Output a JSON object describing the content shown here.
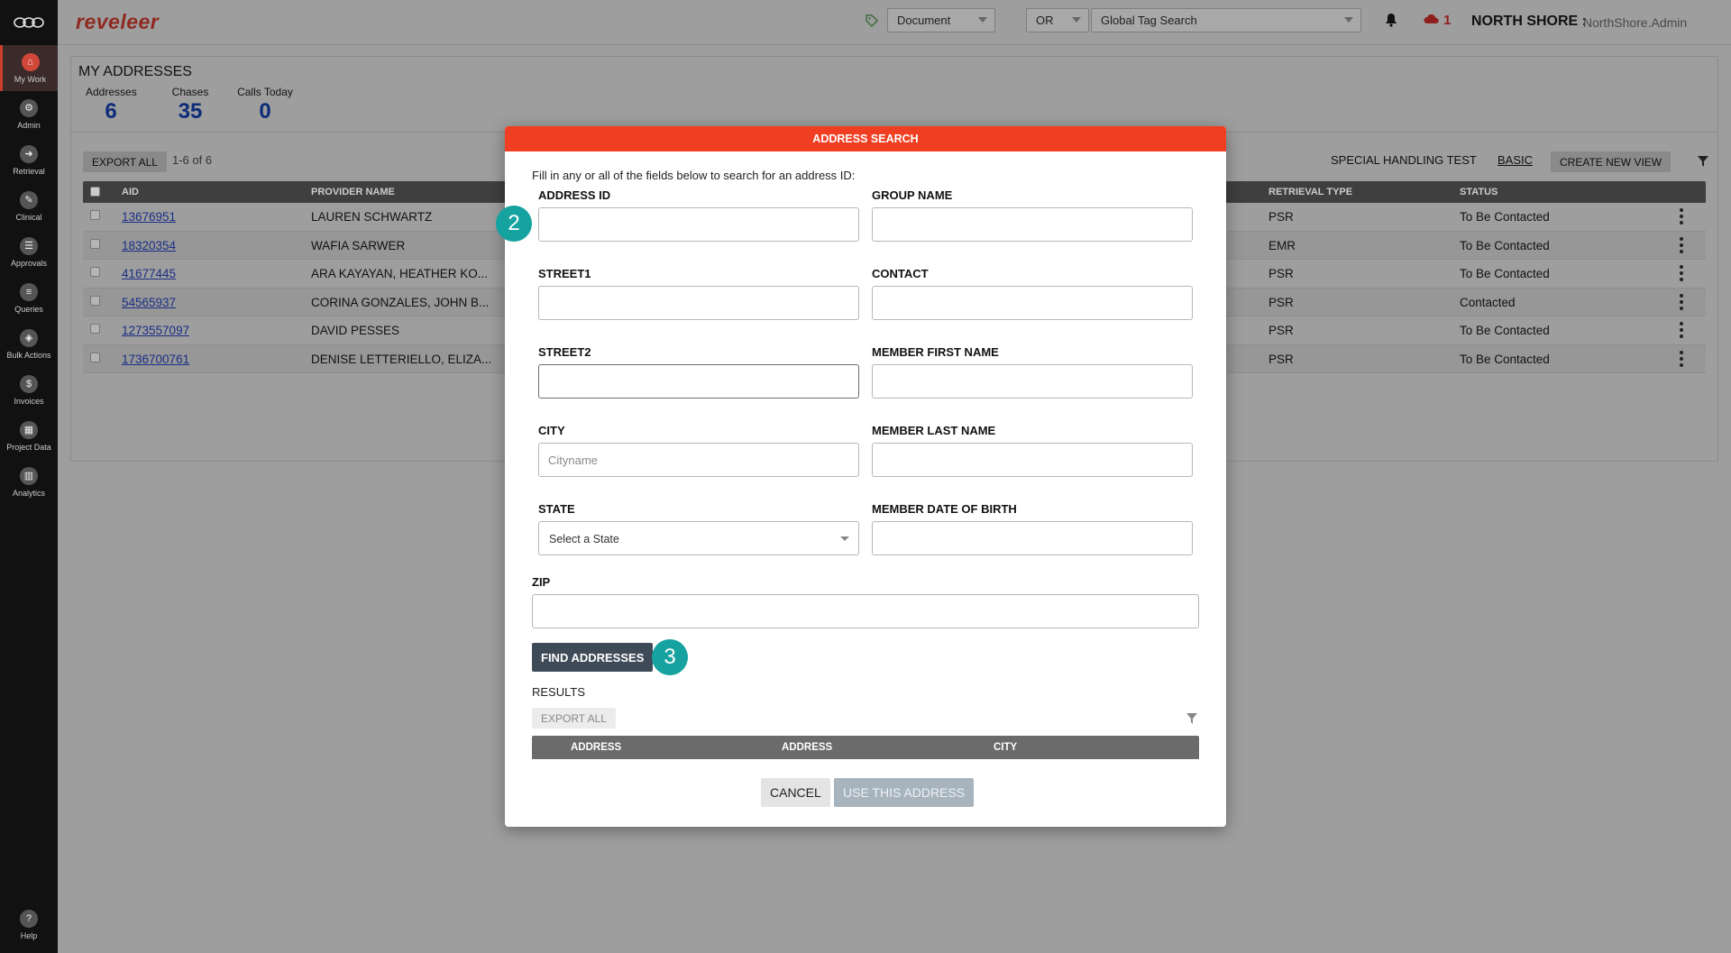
{
  "app": {
    "brand": "reveleer",
    "org": "NORTH SHORE :",
    "user": "NorthShore.Admin",
    "notification_count": "1",
    "search": {
      "type": "Document",
      "operator": "OR",
      "placeholder": "Global Tag Search"
    }
  },
  "sidebar": {
    "items": [
      {
        "label": "My Work",
        "icon": "home-icon"
      },
      {
        "label": "Admin",
        "icon": "admin-icon"
      },
      {
        "label": "Retrieval",
        "icon": "retrieval-icon"
      },
      {
        "label": "Clinical",
        "icon": "clinical-icon"
      },
      {
        "label": "Approvals",
        "icon": "approvals-icon"
      },
      {
        "label": "Queries",
        "icon": "queries-icon"
      },
      {
        "label": "Bulk Actions",
        "icon": "bulk-actions-icon"
      },
      {
        "label": "Invoices",
        "icon": "invoices-icon"
      },
      {
        "label": "Project Data",
        "icon": "project-data-icon"
      },
      {
        "label": "Analytics",
        "icon": "analytics-icon"
      }
    ],
    "help": "Help"
  },
  "page": {
    "title": "MY ADDRESSES",
    "stats": [
      {
        "label": "Addresses",
        "value": "6"
      },
      {
        "label": "Chases",
        "value": "35"
      },
      {
        "label": "Calls Today",
        "value": "0"
      }
    ],
    "export_all": "EXPORT ALL",
    "pagination": "1-6  of  6",
    "view_name": "SPECIAL HANDLING TEST",
    "basic": "BASIC",
    "create_view": "CREATE NEW VIEW",
    "columns": {
      "aid": "AID",
      "provider": "PROVIDER NAME",
      "retrieval": "RETRIEVAL TYPE",
      "status": "STATUS"
    },
    "rows": [
      {
        "aid": "13676951",
        "provider": "LAUREN SCHWARTZ",
        "retrieval": "PSR",
        "status": "To Be Contacted"
      },
      {
        "aid": "18320354",
        "provider": "WAFIA SARWER",
        "retrieval": "EMR",
        "status": "To Be Contacted"
      },
      {
        "aid": "41677445",
        "provider": "ARA KAYAYAN, HEATHER KO...",
        "retrieval": "PSR",
        "status": "To Be Contacted"
      },
      {
        "aid": "54565937",
        "provider": "CORINA GONZALES, JOHN B...",
        "retrieval": "PSR",
        "status": "Contacted"
      },
      {
        "aid": "1273557097",
        "provider": "DAVID PESSES",
        "retrieval": "PSR",
        "status": "To Be Contacted"
      },
      {
        "aid": "1736700761",
        "provider": "DENISE LETTERIELLO, ELIZA...",
        "retrieval": "PSR",
        "status": "To Be Contacted"
      }
    ]
  },
  "modal": {
    "title": "ADDRESS SEARCH",
    "intro": "Fill in any or all of the fields below to search for an address ID:",
    "fields": {
      "address_id": {
        "label": "ADDRESS ID",
        "value": ""
      },
      "group_name": {
        "label": "GROUP NAME",
        "value": ""
      },
      "street1": {
        "label": "STREET1",
        "value": ""
      },
      "contact": {
        "label": "CONTACT",
        "value": ""
      },
      "street2": {
        "label": "STREET2",
        "value": ""
      },
      "member_first_name": {
        "label": "MEMBER FIRST NAME",
        "value": ""
      },
      "city": {
        "label": "CITY",
        "placeholder": "Cityname"
      },
      "member_last_name": {
        "label": "MEMBER LAST NAME",
        "value": ""
      },
      "state": {
        "label": "STATE",
        "selected": "Select a State"
      },
      "member_dob": {
        "label": "MEMBER DATE OF BIRTH",
        "value": ""
      },
      "zip": {
        "label": "ZIP",
        "value": ""
      }
    },
    "find_button": "FIND ADDRESSES",
    "results_label": "RESULTS",
    "results_export": "EXPORT ALL",
    "results_columns": [
      "ADDRESS",
      "ADDRESS",
      "CITY"
    ],
    "cancel": "CANCEL",
    "use_address": "USE THIS ADDRESS",
    "step_badges": [
      "2",
      "3"
    ]
  },
  "colors": {
    "modal_header": "#f03e22",
    "brand": "#8f2a22",
    "badge": "#16a3a0",
    "find_button": "#3f4a58"
  }
}
